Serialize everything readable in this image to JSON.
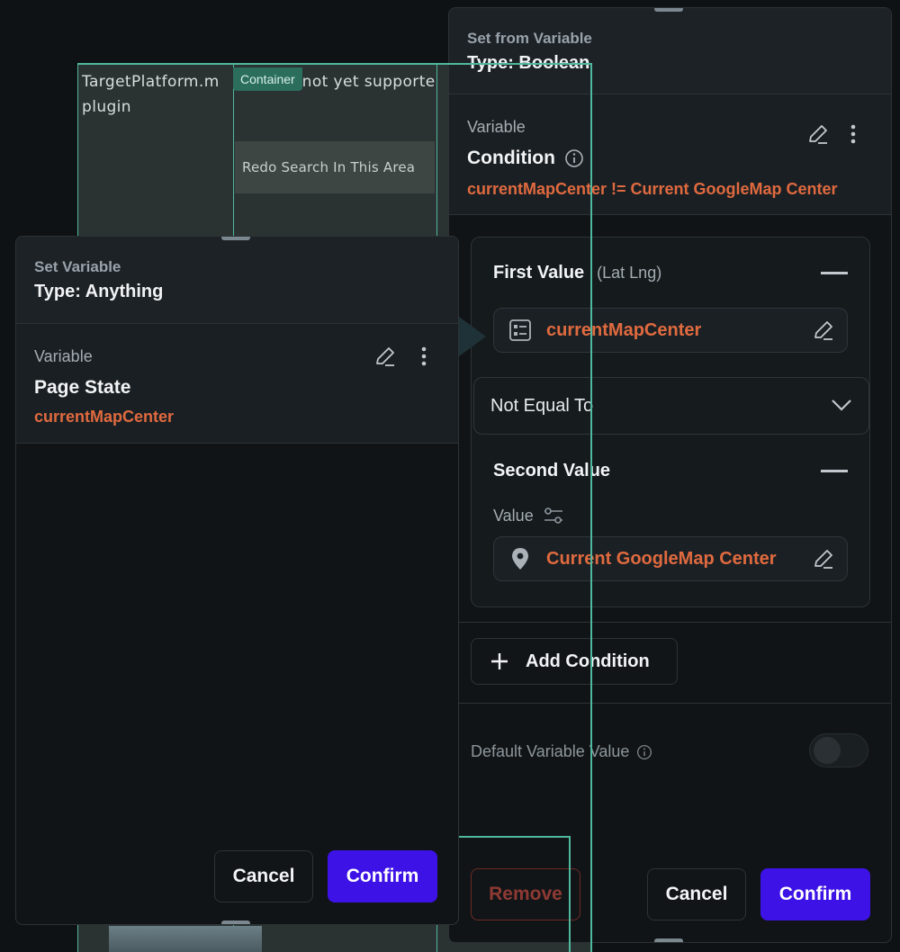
{
  "canvas": {
    "text_line1": "TargetPlatform.m",
    "text_line1b": "not yet supporte",
    "text_line2": "plugin",
    "container_tag": "Container",
    "redo_button": "Redo Search In This Area"
  },
  "right_panel": {
    "header_sub": "Set from Variable",
    "header_title": "Type: Boolean",
    "var_label": "Variable",
    "condition_title": "Condition",
    "condition_expr": "currentMapCenter  !=  Current GoogleMap Center",
    "first_value_label": "First Value",
    "first_value_type": "(Lat Lng)",
    "first_value": "currentMapCenter",
    "operator": "Not Equal To",
    "second_value_label": "Second Value",
    "value_label": "Value",
    "second_value": "Current GoogleMap Center",
    "add_condition": "Add Condition",
    "default_value_label": "Default Variable Value",
    "remove": "Remove",
    "cancel": "Cancel",
    "confirm": "Confirm"
  },
  "left_panel": {
    "header_sub": "Set Variable",
    "header_title": "Type: Anything",
    "var_label": "Variable",
    "var_type": "Page State",
    "var_name": "currentMapCenter",
    "cancel": "Cancel",
    "confirm": "Confirm"
  },
  "colors": {
    "accent_orange": "#e06a3f",
    "primary_button": "#3d12e6",
    "selection_green": "#4fb89e"
  },
  "icons": [
    "edit-icon",
    "more-vert-icon",
    "info-icon",
    "minus-icon",
    "table-icon",
    "chevron-down-icon",
    "sliders-icon",
    "location-pin-icon",
    "plus-icon"
  ]
}
